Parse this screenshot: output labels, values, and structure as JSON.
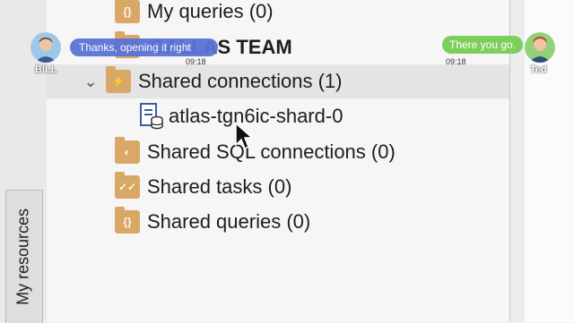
{
  "sidebar": {
    "tab_label": "My resources"
  },
  "tree": {
    "my_queries": "My queries (0)",
    "team_name": "DALLAS TEAM",
    "shared_connections": "Shared connections (1)",
    "connection": "atlas-tgn6ic-shard-0",
    "shared_sql_connections": "Shared SQL connections (0)",
    "shared_tasks": "Shared tasks (0)",
    "shared_queries": "Shared queries (0)"
  },
  "chat": {
    "left": {
      "user": "BILL",
      "message": "Thanks, opening it right",
      "time": "09:18"
    },
    "right": {
      "user": "Ted",
      "message": "There you go.",
      "time": "09:18"
    }
  },
  "colors": {
    "folder": "#d9a766",
    "bubble_left": "#5b73d6",
    "bubble_right": "#7dcf5c"
  }
}
